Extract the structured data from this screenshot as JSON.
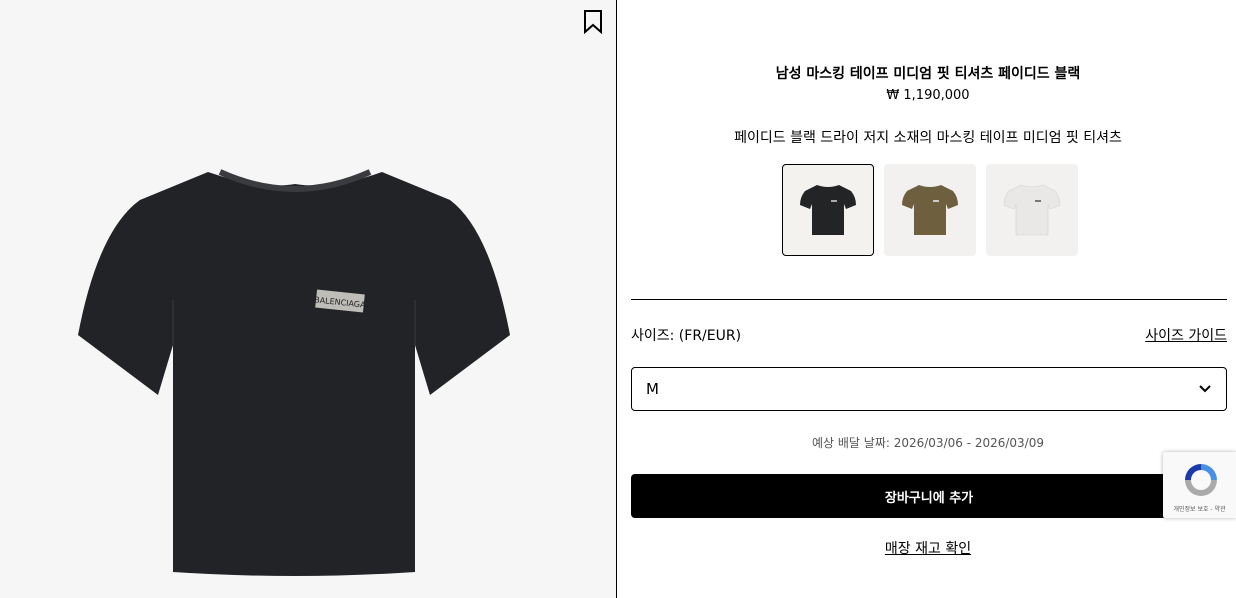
{
  "product": {
    "title": "남성 마스킹 테이프 미디엄 핏 티셔츠 페이디드 블랙",
    "price": "₩ 1,190,000",
    "description": "페이디드 블랙 드라이 저지 소재의 마스킹 테이프 미디엄 핏 티셔츠",
    "logo_text": "BALENCIAGA"
  },
  "swatches": [
    {
      "color_name": "faded-black",
      "color": "#232426",
      "selected": true
    },
    {
      "color_name": "olive",
      "color": "#6e5f3f",
      "selected": false
    },
    {
      "color_name": "white",
      "color": "#e9e8e6",
      "selected": false
    }
  ],
  "size": {
    "label": "사이즈: (FR/EUR)",
    "guide_label": "사이즈 가이드",
    "selected_value": "M"
  },
  "delivery": {
    "text": "예상 배달 날짜: 2026/03/06 - 2026/03/09"
  },
  "actions": {
    "add_to_cart": "장바구니에 추가",
    "check_store_stock": "매장 재고 확인"
  },
  "recaptcha": {
    "text": "개인정보 보호 - 약관"
  },
  "icons": {
    "bookmark": "bookmark-icon",
    "chevron": "chevron-down-icon",
    "recaptcha": "recaptcha-icon"
  }
}
